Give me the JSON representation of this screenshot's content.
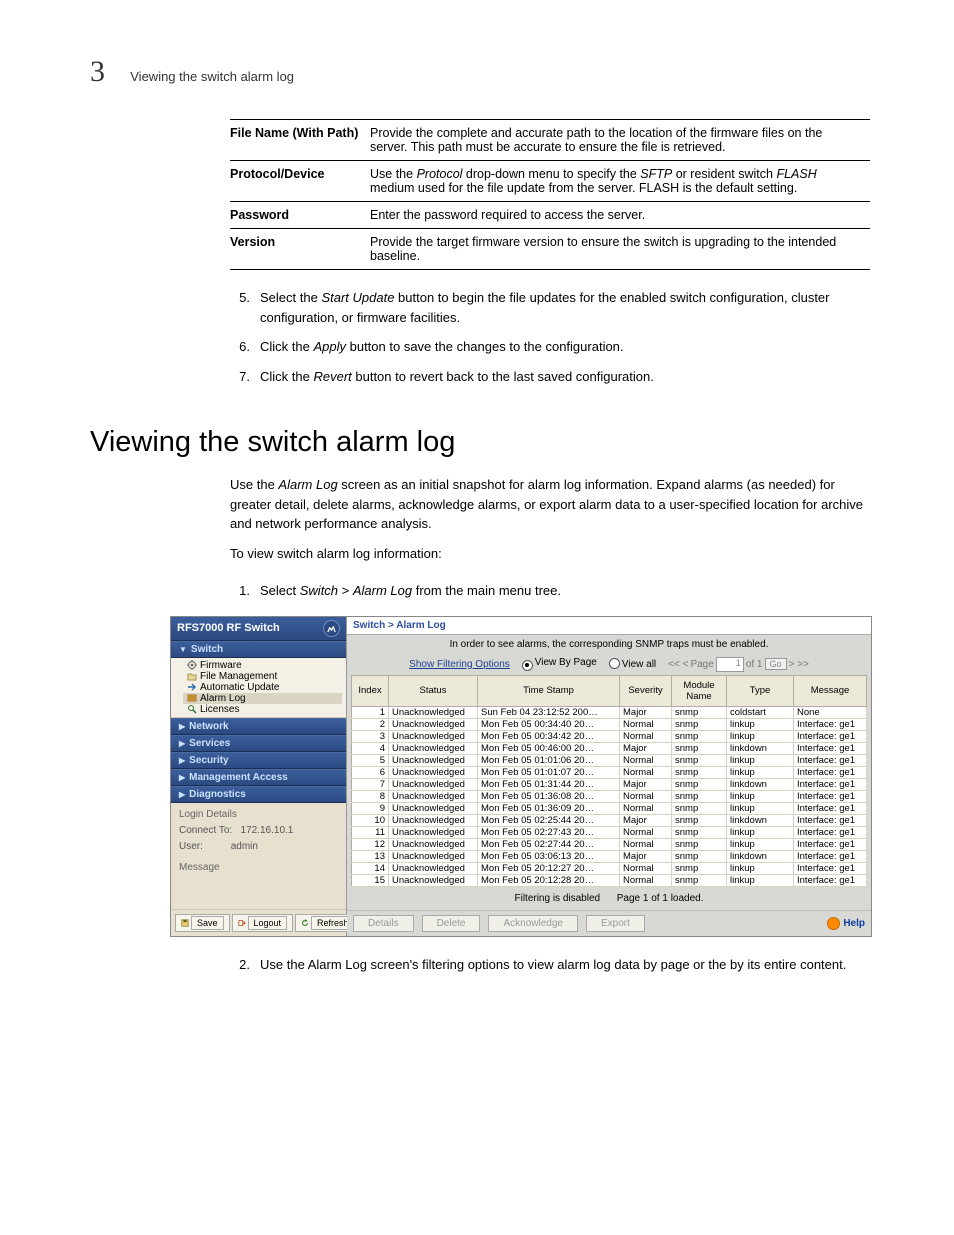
{
  "page_header": {
    "chapter_number": "3",
    "running_head": "Viewing the switch alarm log"
  },
  "param_table": [
    {
      "label": "File Name (With Path)",
      "desc_html": "Provide the complete and accurate path to the location of the firmware files on the server. This path must be accurate to ensure the file is retrieved."
    },
    {
      "label": "Protocol/Device",
      "desc_html": "Use the <em class='ui'>Protocol</em> drop-down menu to specify the <em class='ui'>SFTP</em> or resident switch <em class='ui'>FLASH</em> medium used for the file update from the server. FLASH is the default setting."
    },
    {
      "label": "Password",
      "desc_html": "Enter the password required to access the server."
    },
    {
      "label": "Version",
      "desc_html": "Provide the target firmware version to ensure the switch is upgrading to the intended baseline."
    }
  ],
  "steps_a": [
    {
      "n": "5.",
      "html": "Select the <em class='ui'>Start Update</em> button to begin the file updates for the enabled switch configuration, cluster configuration, or firmware facilities."
    },
    {
      "n": "6.",
      "html": "Click the <em class='ui'>Apply</em> button to save the changes to the configuration."
    },
    {
      "n": "7.",
      "html": "Click the <em class='ui'>Revert</em> button to revert back to the last saved configuration."
    }
  ],
  "section_heading": "Viewing the switch alarm log",
  "intro_para_html": "Use the <em class='ui'>Alarm Log</em> screen as an initial snapshot for alarm log information. Expand alarms (as needed) for greater detail, delete alarms, acknowledge alarms, or export alarm data to a user-specified location for archive and network performance analysis.",
  "intro_lead": "To view switch alarm log information:",
  "steps_b": [
    {
      "n": "1.",
      "html": "Select <em class='ui'>Switch</em> > <em class='ui'>Alarm Log</em> from the main menu tree."
    }
  ],
  "steps_c": [
    {
      "n": "2.",
      "html": "Use the Alarm Log screen's filtering options to view alarm log data by page or the by its entire content."
    }
  ],
  "screenshot": {
    "titlebar": "RFS7000 RF Switch",
    "nav_sections": [
      "Switch",
      "Network",
      "Services",
      "Security",
      "Management Access",
      "Diagnostics"
    ],
    "tree_items": [
      "Firmware",
      "File Management",
      "Automatic Update",
      "Alarm Log",
      "Licenses"
    ],
    "tree_selected": "Alarm Log",
    "login_heading": "Login Details",
    "login_connect_label": "Connect To:",
    "login_connect_value": "172.16.10.1",
    "login_user_label": "User:",
    "login_user_value": "admin",
    "login_message_label": "Message",
    "bottom_buttons": [
      "Save",
      "Logout",
      "Refresh"
    ],
    "breadcrumb": "Switch > Alarm Log",
    "notice": "In order to see alarms, the corresponding SNMP traps must be enabled.",
    "filter_link": "Show Filtering Options",
    "view_by_page": "View By Page",
    "view_all": "View all",
    "page_nav_prev": "<< <",
    "page_label": "Page",
    "page_value": "1",
    "page_of": "of 1",
    "go_label": "Go",
    "page_nav_next": "> >>",
    "grid_headers": [
      "Index",
      "Status",
      "Time Stamp",
      "Severity",
      "Module Name",
      "Type",
      "Message"
    ],
    "rows": [
      {
        "idx": "1",
        "status": "Unacknowledged",
        "ts": "Sun Feb 04 23:12:52 200…",
        "sev": "Major",
        "mod": "snmp",
        "type": "coldstart",
        "msg": "None"
      },
      {
        "idx": "2",
        "status": "Unacknowledged",
        "ts": "Mon Feb 05 00:34:40 20…",
        "sev": "Normal",
        "mod": "snmp",
        "type": "linkup",
        "msg": "Interface: ge1"
      },
      {
        "idx": "3",
        "status": "Unacknowledged",
        "ts": "Mon Feb 05 00:34:42 20…",
        "sev": "Normal",
        "mod": "snmp",
        "type": "linkup",
        "msg": "Interface: ge1"
      },
      {
        "idx": "4",
        "status": "Unacknowledged",
        "ts": "Mon Feb 05 00:46:00 20…",
        "sev": "Major",
        "mod": "snmp",
        "type": "linkdown",
        "msg": "Interface: ge1"
      },
      {
        "idx": "5",
        "status": "Unacknowledged",
        "ts": "Mon Feb 05 01:01:06 20…",
        "sev": "Normal",
        "mod": "snmp",
        "type": "linkup",
        "msg": "Interface: ge1"
      },
      {
        "idx": "6",
        "status": "Unacknowledged",
        "ts": "Mon Feb 05 01:01:07 20…",
        "sev": "Normal",
        "mod": "snmp",
        "type": "linkup",
        "msg": "Interface: ge1"
      },
      {
        "idx": "7",
        "status": "Unacknowledged",
        "ts": "Mon Feb 05 01:31:44 20…",
        "sev": "Major",
        "mod": "snmp",
        "type": "linkdown",
        "msg": "Interface: ge1"
      },
      {
        "idx": "8",
        "status": "Unacknowledged",
        "ts": "Mon Feb 05 01:36:08 20…",
        "sev": "Normal",
        "mod": "snmp",
        "type": "linkup",
        "msg": "Interface: ge1"
      },
      {
        "idx": "9",
        "status": "Unacknowledged",
        "ts": "Mon Feb 05 01:36:09 20…",
        "sev": "Normal",
        "mod": "snmp",
        "type": "linkup",
        "msg": "Interface: ge1"
      },
      {
        "idx": "10",
        "status": "Unacknowledged",
        "ts": "Mon Feb 05 02:25:44 20…",
        "sev": "Major",
        "mod": "snmp",
        "type": "linkdown",
        "msg": "Interface: ge1"
      },
      {
        "idx": "11",
        "status": "Unacknowledged",
        "ts": "Mon Feb 05 02:27:43 20…",
        "sev": "Normal",
        "mod": "snmp",
        "type": "linkup",
        "msg": "Interface: ge1"
      },
      {
        "idx": "12",
        "status": "Unacknowledged",
        "ts": "Mon Feb 05 02:27:44 20…",
        "sev": "Normal",
        "mod": "snmp",
        "type": "linkup",
        "msg": "Interface: ge1"
      },
      {
        "idx": "13",
        "status": "Unacknowledged",
        "ts": "Mon Feb 05 03:06:13 20…",
        "sev": "Major",
        "mod": "snmp",
        "type": "linkdown",
        "msg": "Interface: ge1"
      },
      {
        "idx": "14",
        "status": "Unacknowledged",
        "ts": "Mon Feb 05 20:12:27 20…",
        "sev": "Normal",
        "mod": "snmp",
        "type": "linkup",
        "msg": "Interface: ge1"
      },
      {
        "idx": "15",
        "status": "Unacknowledged",
        "ts": "Mon Feb 05 20:12:28 20…",
        "sev": "Normal",
        "mod": "snmp",
        "type": "linkup",
        "msg": "Interface: ge1"
      }
    ],
    "status_filter": "Filtering is disabled",
    "status_page": "Page 1 of 1 loaded.",
    "action_buttons": [
      "Details",
      "Delete",
      "Acknowledge",
      "Export"
    ],
    "help_label": "Help"
  }
}
